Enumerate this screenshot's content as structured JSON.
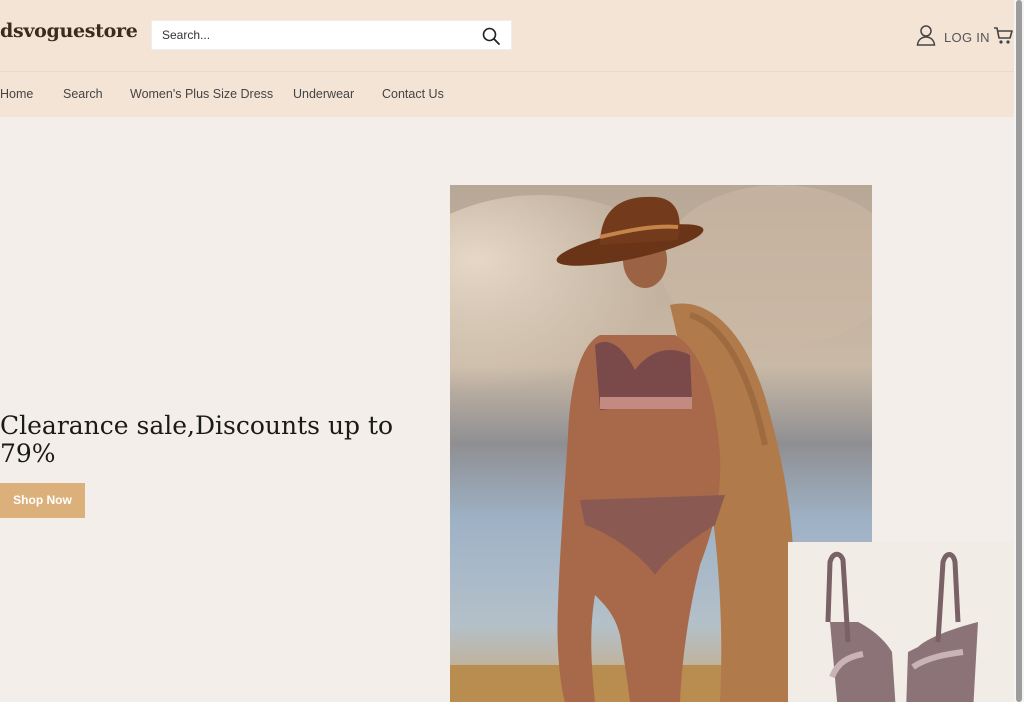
{
  "header": {
    "logo": "dsvoguestore",
    "search_placeholder": "Search...",
    "login_label": "LOG IN"
  },
  "nav": {
    "items": [
      {
        "label": "Home"
      },
      {
        "label": "Search"
      },
      {
        "label": "Women's Plus Size Dress"
      },
      {
        "label": "Underwear"
      },
      {
        "label": "Contact Us"
      }
    ]
  },
  "hero": {
    "title": "Clearance sale,Discounts up to 79%",
    "button_label": "Shop Now"
  },
  "icons": {
    "search": "search-icon",
    "user": "user-icon",
    "cart": "cart-icon"
  },
  "colors": {
    "header_bg": "#f3e4d6",
    "page_bg": "#f3eee9",
    "accent": "#dcb07b"
  }
}
